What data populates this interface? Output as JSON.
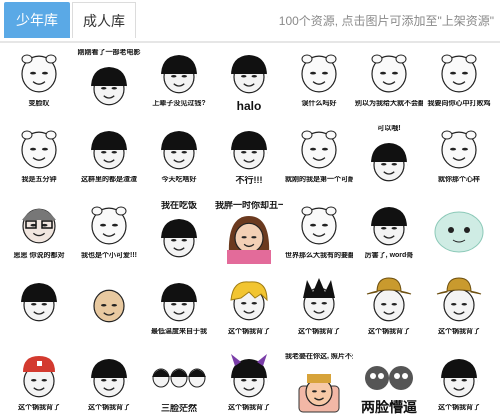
{
  "tabs": [
    {
      "label": "少年库",
      "active": true
    },
    {
      "label": "成人库",
      "active": false
    }
  ],
  "notice": "100个资源, 点击图片可添加至\"上架资源\"",
  "accent_color": "#5aa9e6",
  "stickers": [
    {
      "caption": "变脸叹",
      "kind": "pig",
      "cap": "small"
    },
    {
      "caption": "刚刚看了一部老电影",
      "kind": "bowl",
      "cap": "small",
      "top": true
    },
    {
      "caption": "上辈子没见过钱?",
      "kind": "bowl",
      "cap": "small"
    },
    {
      "caption": "halo",
      "kind": "bowl",
      "cap": "big"
    },
    {
      "caption": "误什么吗好",
      "kind": "pig",
      "cap": "small"
    },
    {
      "caption": "别以为我给大就不会翻脸",
      "kind": "pig",
      "cap": "small"
    },
    {
      "caption": "我要向你心中打败鸡",
      "kind": "pig",
      "cap": "small"
    },
    {
      "caption": "我是五分钟",
      "kind": "pig",
      "cap": "small"
    },
    {
      "caption": "这群里的都是渣渣",
      "kind": "bowl",
      "cap": "small"
    },
    {
      "caption": "今天吃啥好",
      "kind": "bowl",
      "cap": "small"
    },
    {
      "caption": "不行!!!",
      "kind": "bowl",
      "cap": "mid"
    },
    {
      "caption": "就刚的我是第一个可耐的",
      "kind": "pig",
      "cap": "small"
    },
    {
      "caption": "可以哦!",
      "kind": "bowl",
      "cap": "small",
      "top": true
    },
    {
      "caption": "就你那个心样",
      "kind": "pig",
      "cap": "small"
    },
    {
      "caption": "思思 你说的都对",
      "kind": "glasses",
      "cap": "small"
    },
    {
      "caption": "我也是个小可爱!!!",
      "kind": "pig",
      "cap": "small"
    },
    {
      "caption": "我在吃饭",
      "kind": "bowl",
      "cap": "mid",
      "top": true
    },
    {
      "caption": "我胖一时你却丑一世",
      "kind": "girl",
      "cap": "mid",
      "top": true
    },
    {
      "caption": "世界那么大我有的要翻墙",
      "kind": "pig",
      "cap": "small"
    },
    {
      "caption": "厉害了, word哥",
      "kind": "bowl",
      "cap": "small"
    },
    {
      "caption": "",
      "kind": "ghost",
      "cap": "small"
    },
    {
      "caption": "",
      "kind": "bowl",
      "cap": "small"
    },
    {
      "caption": "",
      "kind": "bald",
      "cap": "small"
    },
    {
      "caption": "最低温度来自于我",
      "kind": "bowl",
      "cap": "small"
    },
    {
      "caption": "这个锅我背了",
      "kind": "blonde",
      "cap": "small"
    },
    {
      "caption": "这个锅我背了",
      "kind": "spiky",
      "cap": "small"
    },
    {
      "caption": "这个锅我背了",
      "kind": "hat",
      "cap": "small"
    },
    {
      "caption": "这个锅我背了",
      "kind": "hat",
      "cap": "small"
    },
    {
      "caption": "这个锅我背了",
      "kind": "cap",
      "cap": "small"
    },
    {
      "caption": "这个锅我背了",
      "kind": "bowl",
      "cap": "small"
    },
    {
      "caption": "三脸茫然",
      "kind": "bowl3",
      "cap": "mid"
    },
    {
      "caption": "这个锅我背了",
      "kind": "horns",
      "cap": "small"
    },
    {
      "caption": "我老婆在你这, 照片不少于三张",
      "kind": "chef",
      "cap": "small",
      "top": true
    },
    {
      "caption": "两脸懵逼",
      "kind": "dark2",
      "cap": "huge"
    },
    {
      "caption": "这个锅我背了",
      "kind": "bowl",
      "cap": "small"
    }
  ]
}
